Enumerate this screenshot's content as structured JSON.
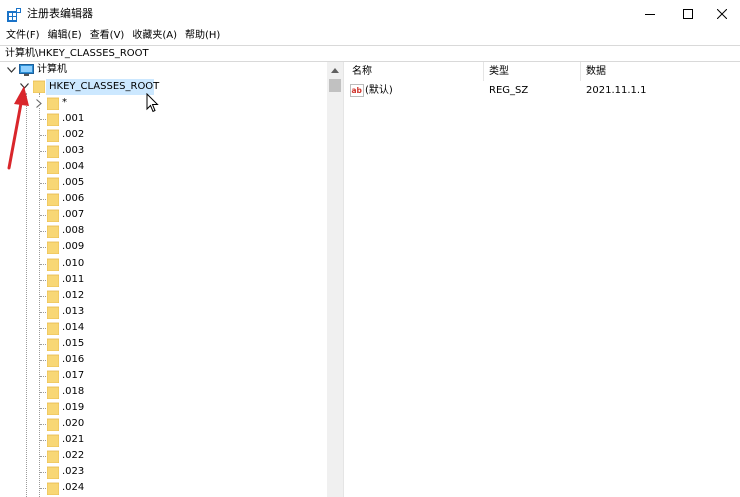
{
  "window": {
    "title": "注册表编辑器",
    "minimize_glyph": "minimize-icon",
    "maximize_glyph": "maximize-icon",
    "close_glyph": "close-icon"
  },
  "menu": {
    "items": [
      "文件(F)",
      "编辑(E)",
      "查看(V)",
      "收藏夹(A)",
      "帮助(H)"
    ]
  },
  "address": {
    "path": "计算机\\HKEY_CLASSES_ROOT"
  },
  "tree": {
    "root_label": "计算机",
    "selected_label": "HKEY_CLASSES_ROOT",
    "children": [
      "*",
      ".001",
      ".002",
      ".003",
      ".004",
      ".005",
      ".006",
      ".007",
      ".008",
      ".009",
      ".010",
      ".011",
      ".012",
      ".013",
      ".014",
      ".015",
      ".016",
      ".017",
      ".018",
      ".019",
      ".020",
      ".021",
      ".022",
      ".023",
      ".024"
    ]
  },
  "list": {
    "columns": [
      "名称",
      "类型",
      "数据"
    ],
    "rows": [
      {
        "name": "(默认)",
        "type": "REG_SZ",
        "data": "2021.11.1.1"
      }
    ]
  },
  "colors": {
    "selection": "#cce8ff",
    "folder": "#f8d775",
    "folder_dark": "#e6b94a",
    "annotation_arrow": "#d9262b"
  }
}
